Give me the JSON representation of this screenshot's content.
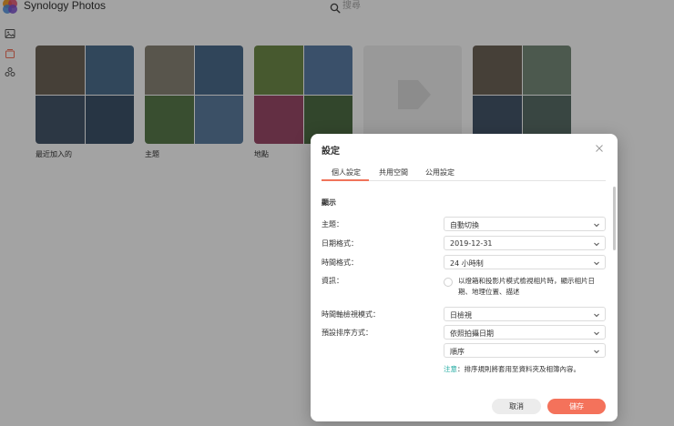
{
  "app": {
    "title": "Synology Photos",
    "search_placeholder": "搜尋"
  },
  "albums": [
    {
      "label": "最近加入的",
      "tiles": [
        "#6e6558",
        "#4d6f8f",
        "#46566b",
        "#3d536b"
      ]
    },
    {
      "label": "主題",
      "tiles": [
        "#8a8578",
        "#4b6d8e",
        "#5a7a4c",
        "#5d7da0"
      ]
    },
    {
      "label": "地點",
      "tiles": [
        "#6f8c4a",
        "#5c7ea6",
        "#9c4a6a",
        "#4f6e46"
      ]
    },
    {
      "label": "",
      "tiles": []
    },
    {
      "label": "",
      "tiles": [
        "#6e6558",
        "#788c7a",
        "#46566b",
        "#5a6e68"
      ]
    }
  ],
  "dialog": {
    "title": "設定",
    "tabs": [
      "個人設定",
      "共用空間",
      "公用設定"
    ],
    "section_title": "顯示",
    "fields": {
      "theme": {
        "label": "主題：",
        "value": "自動切換"
      },
      "date_format": {
        "label": "日期格式：",
        "value": "2019-12-31"
      },
      "time_format": {
        "label": "時間格式：",
        "value": "24 小時制"
      },
      "info": {
        "label": "資訊：",
        "text": "以燈箱和投影片模式檢視相片時，顯示相片日期、地理位置、描述"
      },
      "timeline_mode": {
        "label": "時間軸檢視模式：",
        "value": "日檢視"
      },
      "sort": {
        "label": "預設排序方式：",
        "value": "依照拍攝日期",
        "order": "順序"
      }
    },
    "note_key": "注意",
    "note_text": "：排序規則將套用至資料夾及相簿內容。",
    "cancel_label": "取消",
    "save_label": "儲存"
  },
  "colors": {
    "accent": "#f4725b",
    "note": "#1fa9a0"
  }
}
